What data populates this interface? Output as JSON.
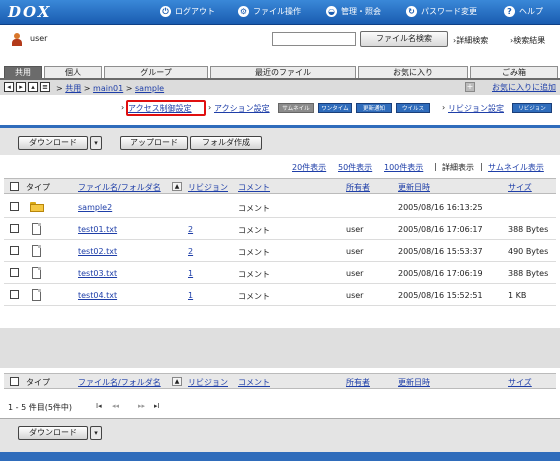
{
  "header": {
    "logo": "DOX",
    "nav": [
      {
        "icon": "logout-icon",
        "label": "ログアウト"
      },
      {
        "icon": "file-operation-icon",
        "label": "ファイル操作"
      },
      {
        "icon": "admin-icon",
        "label": "管理・照会"
      },
      {
        "icon": "password-change-icon",
        "label": "パスワード変更"
      },
      {
        "icon": "help-icon",
        "label": "ヘルプ"
      }
    ]
  },
  "userbar": {
    "username": "user",
    "search_placeholder": "",
    "search_button": "ファイル名検索",
    "detail_search": "詳細検索",
    "search_results": "検索結果"
  },
  "tabs": [
    {
      "label": "共用",
      "active": true
    },
    {
      "label": "個人",
      "active": false
    },
    {
      "label": "グループ",
      "active": false
    },
    {
      "label": "最近のファイル",
      "active": false
    },
    {
      "label": "お気に入り",
      "active": false
    },
    {
      "label": "ごみ箱",
      "active": false
    }
  ],
  "path": {
    "crumbs": [
      "共用",
      "main01",
      "sample"
    ],
    "add_favorite": "お気に入りに追加"
  },
  "actions": {
    "access_control": "アクセス制御設定",
    "action_settings": "アクション設定",
    "badges": [
      "サムネイル",
      "ワンタイム",
      "更新通知",
      "ウイルス"
    ],
    "revision_settings": "リビジョン設定",
    "revision_badge": "リビジョン"
  },
  "toolbar": {
    "download": "ダウンロード",
    "upload": "アップロード",
    "create_folder": "フォルダ作成"
  },
  "views": {
    "options": [
      "20件表示",
      "50件表示",
      "100件表示"
    ],
    "detail": "詳細表示",
    "thumbnail": "サムネイル表示"
  },
  "table": {
    "columns": [
      "タイプ",
      "ファイル名/フォルダ名",
      "リビジョン",
      "コメント",
      "所有者",
      "更新日時",
      "サイズ"
    ],
    "rows": [
      {
        "type": "folder",
        "name": "sample2",
        "revision": "",
        "comment": "コメント",
        "owner": "",
        "updated": "2005/08/16 16:13:25",
        "size": ""
      },
      {
        "type": "file",
        "name": "test01.txt",
        "revision": "2",
        "comment": "コメント",
        "owner": "user",
        "updated": "2005/08/16 17:06:17",
        "size": "388 Bytes"
      },
      {
        "type": "file",
        "name": "test02.txt",
        "revision": "2",
        "comment": "コメント",
        "owner": "user",
        "updated": "2005/08/16 15:53:37",
        "size": "490 Bytes"
      },
      {
        "type": "file",
        "name": "test03.txt",
        "revision": "1",
        "comment": "コメント",
        "owner": "user",
        "updated": "2005/08/16 17:06:19",
        "size": "388 Bytes"
      },
      {
        "type": "file",
        "name": "test04.txt",
        "revision": "1",
        "comment": "コメント",
        "owner": "user",
        "updated": "2005/08/16 15:52:51",
        "size": "1 KB"
      }
    ]
  },
  "pager": {
    "summary": "1 - 5 件目(5件中)",
    "nav": [
      "I◂",
      "◂◂",
      "▸▸",
      "▸I"
    ]
  },
  "bottom": {
    "download": "ダウンロード"
  },
  "colors": {
    "header_blue": "#2f6cbb",
    "link_blue": "#1e3ea8",
    "highlight_red": "#e01010"
  }
}
